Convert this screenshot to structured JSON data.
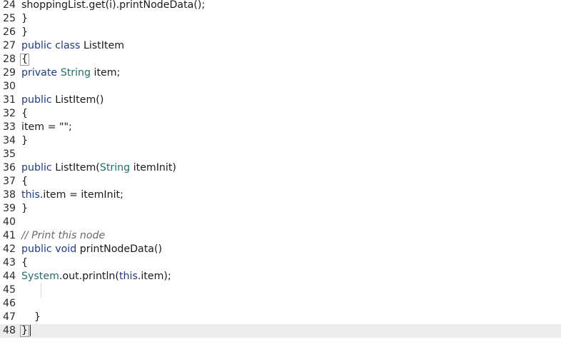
{
  "editor": {
    "lines": [
      {
        "n": "24",
        "indent": "",
        "tokens": [
          {
            "t": "plain",
            "v": "shoppingList.get(i).printNodeData();"
          }
        ]
      },
      {
        "n": "25",
        "indent": "",
        "tokens": [
          {
            "t": "plain",
            "v": "}"
          }
        ]
      },
      {
        "n": "26",
        "indent": "",
        "tokens": [
          {
            "t": "plain",
            "v": "}"
          }
        ]
      },
      {
        "n": "27",
        "indent": "",
        "tokens": [
          {
            "t": "kw",
            "v": "public"
          },
          {
            "t": "plain",
            "v": " "
          },
          {
            "t": "kw",
            "v": "class"
          },
          {
            "t": "plain",
            "v": " ListItem"
          }
        ]
      },
      {
        "n": "28",
        "indent": "",
        "tokens": [
          {
            "t": "brace",
            "v": "{"
          }
        ]
      },
      {
        "n": "29",
        "indent": "",
        "tokens": [
          {
            "t": "kw",
            "v": "private"
          },
          {
            "t": "plain",
            "v": " "
          },
          {
            "t": "type",
            "v": "String"
          },
          {
            "t": "plain",
            "v": " item;"
          }
        ]
      },
      {
        "n": "30",
        "indent": "",
        "tokens": []
      },
      {
        "n": "31",
        "indent": "",
        "tokens": [
          {
            "t": "kw",
            "v": "public"
          },
          {
            "t": "plain",
            "v": " ListItem()"
          }
        ]
      },
      {
        "n": "32",
        "indent": "",
        "tokens": [
          {
            "t": "plain",
            "v": "{"
          }
        ]
      },
      {
        "n": "33",
        "indent": "",
        "tokens": [
          {
            "t": "plain",
            "v": "item = \"\";"
          }
        ]
      },
      {
        "n": "34",
        "indent": "",
        "tokens": [
          {
            "t": "plain",
            "v": "}"
          }
        ]
      },
      {
        "n": "35",
        "indent": "",
        "tokens": []
      },
      {
        "n": "36",
        "indent": "",
        "tokens": [
          {
            "t": "kw",
            "v": "public"
          },
          {
            "t": "plain",
            "v": " ListItem("
          },
          {
            "t": "type",
            "v": "String"
          },
          {
            "t": "plain",
            "v": " itemInit)"
          }
        ]
      },
      {
        "n": "37",
        "indent": "",
        "tokens": [
          {
            "t": "plain",
            "v": "{"
          }
        ]
      },
      {
        "n": "38",
        "indent": "",
        "tokens": [
          {
            "t": "kw",
            "v": "this"
          },
          {
            "t": "plain",
            "v": ".item = itemInit;"
          }
        ]
      },
      {
        "n": "39",
        "indent": "",
        "tokens": [
          {
            "t": "plain",
            "v": "}"
          }
        ]
      },
      {
        "n": "40",
        "indent": "",
        "tokens": []
      },
      {
        "n": "41",
        "indent": "",
        "tokens": [
          {
            "t": "cmt",
            "v": "// Print this node"
          }
        ]
      },
      {
        "n": "42",
        "indent": "",
        "tokens": [
          {
            "t": "kw",
            "v": "public"
          },
          {
            "t": "plain",
            "v": " "
          },
          {
            "t": "kw",
            "v": "void"
          },
          {
            "t": "plain",
            "v": " printNodeData()"
          }
        ]
      },
      {
        "n": "43",
        "indent": "",
        "tokens": [
          {
            "t": "plain",
            "v": "{"
          }
        ]
      },
      {
        "n": "44",
        "indent": "",
        "tokens": [
          {
            "t": "type",
            "v": "System"
          },
          {
            "t": "plain",
            "v": ".out.println("
          },
          {
            "t": "kw",
            "v": "this"
          },
          {
            "t": "plain",
            "v": ".item);"
          }
        ]
      },
      {
        "n": "45",
        "indent": "",
        "tokens": []
      },
      {
        "n": "46",
        "indent": "",
        "tokens": []
      },
      {
        "n": "47",
        "indent": "    ",
        "tokens": [
          {
            "t": "plain",
            "v": "}"
          }
        ]
      },
      {
        "n": "48",
        "indent": "",
        "tokens": [
          {
            "t": "brace",
            "v": "}"
          },
          {
            "t": "caret",
            "v": ""
          }
        ],
        "current": true
      }
    ]
  },
  "colors": {
    "keyword": "#1d3a8a",
    "type": "#1f6f6a",
    "comment": "#6a6a6a",
    "current_line": "#ececec"
  }
}
